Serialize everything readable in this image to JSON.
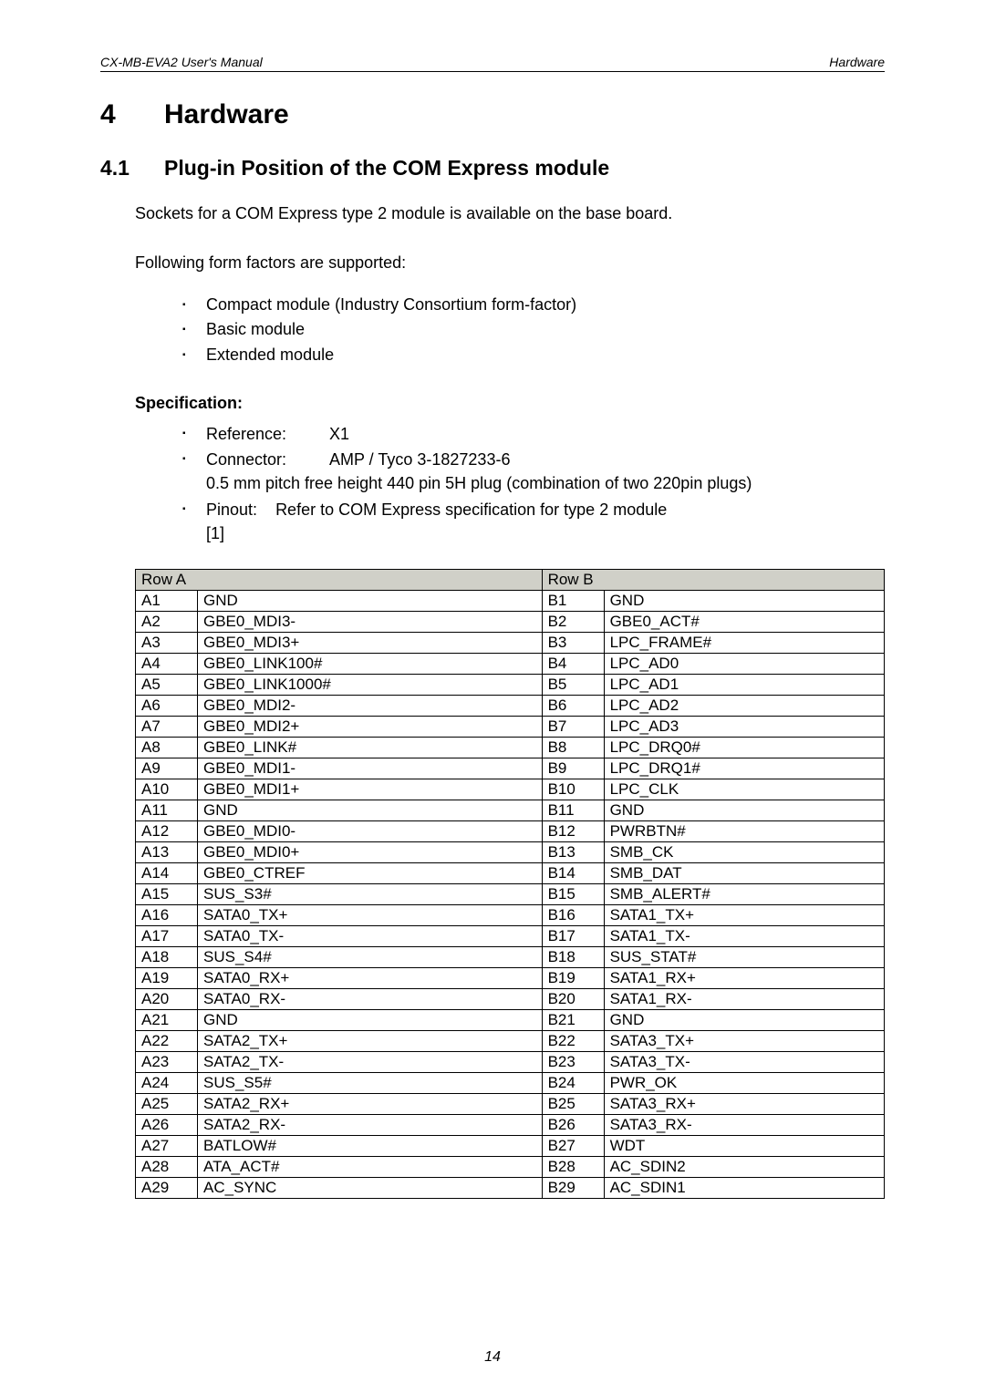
{
  "header": {
    "left": "CX-MB-EVA2  User's Manual",
    "right": "Hardware"
  },
  "h1": {
    "num": "4",
    "title": "Hardware"
  },
  "h2": {
    "num": "4.1",
    "title": "Plug-in Position of the COM Express module"
  },
  "p1": "Sockets for a COM Express type 2 module is available on the base board.",
  "p2": "Following form factors are supported:",
  "formfactors": [
    "Compact module (Industry Consortium form-factor)",
    "Basic module",
    "Extended module"
  ],
  "spec_heading": "Specification:",
  "spec": {
    "ref_label": "Reference:",
    "ref_value": "X1",
    "conn_label": "Connector:",
    "conn_value": "AMP / Tyco 3-1827233-6",
    "conn_detail": "0.5 mm pitch free height 440 pin 5H plug (combination of two 220pin plugs)",
    "pinout_label": "Pinout:",
    "pinout_value": "Refer to COM Express specification for type 2 module",
    "pinout_ref": "[1]"
  },
  "table": {
    "headA": "Row A",
    "headB": "Row B",
    "rows": [
      {
        "ap": "A1",
        "as": "GND",
        "bp": "B1",
        "bs": "GND"
      },
      {
        "ap": "A2",
        "as": "GBE0_MDI3-",
        "bp": "B2",
        "bs": "GBE0_ACT#"
      },
      {
        "ap": "A3",
        "as": "GBE0_MDI3+",
        "bp": "B3",
        "bs": "LPC_FRAME#"
      },
      {
        "ap": "A4",
        "as": "GBE0_LINK100#",
        "bp": "B4",
        "bs": "LPC_AD0"
      },
      {
        "ap": "A5",
        "as": "GBE0_LINK1000#",
        "bp": "B5",
        "bs": "LPC_AD1"
      },
      {
        "ap": "A6",
        "as": "GBE0_MDI2-",
        "bp": "B6",
        "bs": "LPC_AD2"
      },
      {
        "ap": "A7",
        "as": "GBE0_MDI2+",
        "bp": "B7",
        "bs": "LPC_AD3"
      },
      {
        "ap": "A8",
        "as": "GBE0_LINK#",
        "bp": "B8",
        "bs": "LPC_DRQ0#"
      },
      {
        "ap": "A9",
        "as": "GBE0_MDI1-",
        "bp": "B9",
        "bs": "LPC_DRQ1#"
      },
      {
        "ap": "A10",
        "as": "GBE0_MDI1+",
        "bp": "B10",
        "bs": "LPC_CLK"
      },
      {
        "ap": "A11",
        "as": "GND",
        "bp": "B11",
        "bs": "GND"
      },
      {
        "ap": "A12",
        "as": "GBE0_MDI0-",
        "bp": "B12",
        "bs": "PWRBTN#"
      },
      {
        "ap": "A13",
        "as": "GBE0_MDI0+",
        "bp": "B13",
        "bs": "SMB_CK"
      },
      {
        "ap": "A14",
        "as": "GBE0_CTREF",
        "bp": "B14",
        "bs": "SMB_DAT"
      },
      {
        "ap": "A15",
        "as": "SUS_S3#",
        "bp": "B15",
        "bs": "SMB_ALERT#"
      },
      {
        "ap": "A16",
        "as": "SATA0_TX+",
        "bp": "B16",
        "bs": "SATA1_TX+"
      },
      {
        "ap": "A17",
        "as": "SATA0_TX-",
        "bp": "B17",
        "bs": "SATA1_TX-"
      },
      {
        "ap": "A18",
        "as": "SUS_S4#",
        "bp": "B18",
        "bs": "SUS_STAT#"
      },
      {
        "ap": "A19",
        "as": "SATA0_RX+",
        "bp": "B19",
        "bs": "SATA1_RX+"
      },
      {
        "ap": "A20",
        "as": "SATA0_RX-",
        "bp": "B20",
        "bs": "SATA1_RX-"
      },
      {
        "ap": "A21",
        "as": "GND",
        "bp": "B21",
        "bs": "GND"
      },
      {
        "ap": "A22",
        "as": "SATA2_TX+",
        "bp": "B22",
        "bs": "SATA3_TX+"
      },
      {
        "ap": "A23",
        "as": "SATA2_TX-",
        "bp": "B23",
        "bs": "SATA3_TX-"
      },
      {
        "ap": "A24",
        "as": "SUS_S5#",
        "bp": "B24",
        "bs": "PWR_OK"
      },
      {
        "ap": "A25",
        "as": "SATA2_RX+",
        "bp": "B25",
        "bs": "SATA3_RX+"
      },
      {
        "ap": "A26",
        "as": "SATA2_RX-",
        "bp": "B26",
        "bs": "SATA3_RX-"
      },
      {
        "ap": "A27",
        "as": "BATLOW#",
        "bp": "B27",
        "bs": "WDT"
      },
      {
        "ap": "A28",
        "as": "ATA_ACT#",
        "bp": "B28",
        "bs": "AC_SDIN2"
      },
      {
        "ap": "A29",
        "as": "AC_SYNC",
        "bp": "B29",
        "bs": "AC_SDIN1"
      }
    ]
  },
  "page_number": "14"
}
